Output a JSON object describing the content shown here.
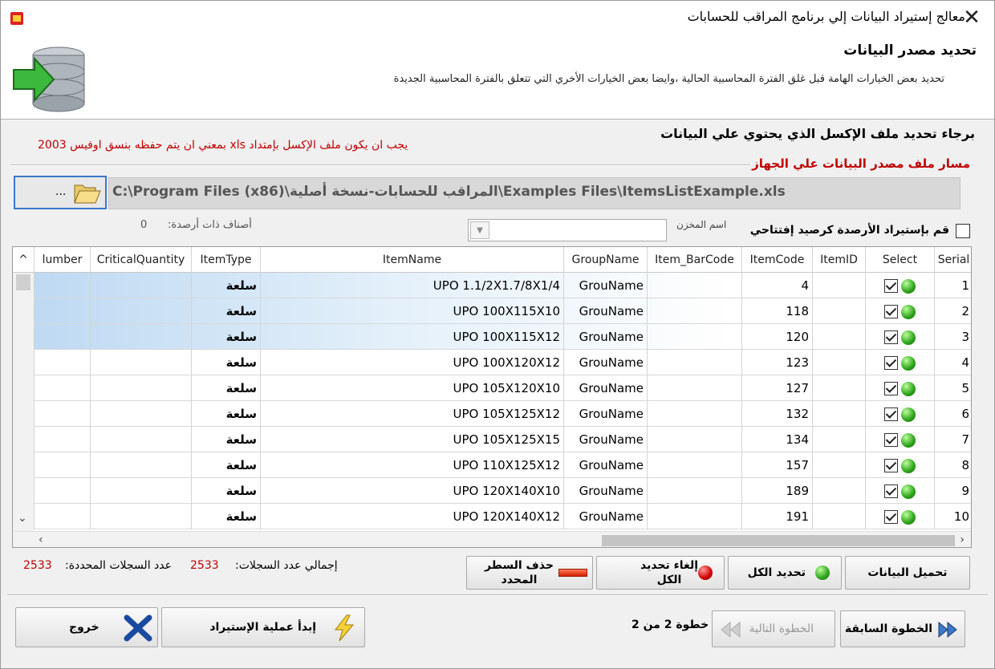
{
  "window": {
    "title": "معالج إستيراد البيانات إلي برنامج المراقب للحسابات"
  },
  "header": {
    "title": "تحديد مصدر البيانات",
    "subtitle": "تحديد بعض الخيارات الهامة قبل غلق الفترة المحاسبية الحالية ،وايضا بعض الخيارات الأخري التي تتعلق بالفترة المحاسبية الجديدة"
  },
  "source": {
    "instruction": "برجاء تحديد ملف الإكسل الذي يحتوي علي البيانات",
    "warning": "يجب ان يكون ملف الإكسل بإمتداد xls بمعني ان يتم حفظه بنسق اوفيس 2003",
    "group_label": "مسار ملف مصدر البيانات علي الجهاز",
    "browse_label": "...",
    "path": "C:\\Program Files (x86)\\المراقب للحسابات-نسخة أصلية\\Examples Files\\ItemsListExample.xls"
  },
  "options": {
    "import_balances_label": "قم بإستيراد الأرصدة كرصيد إفتتاحي",
    "warehouse_label": "اسم المخزن",
    "warehouse_value": "",
    "items_with_balance_label": "أصناف ذات أرصدة:",
    "items_with_balance_value": "0"
  },
  "grid": {
    "columns": [
      "Serial",
      "Select",
      "ItemID",
      "ItemCode",
      "Item_BarCode",
      "GroupName",
      "ItemName",
      "ItemType",
      "CriticalQuantity",
      "lumber"
    ],
    "rows": [
      {
        "serial": "1",
        "item_id": "",
        "item_code": "4",
        "barcode": "",
        "group": "GrouName",
        "name": "UPO 1.1/2X1.7/8X1/4",
        "type": "سلعة",
        "critical": "",
        "number": ""
      },
      {
        "serial": "2",
        "item_id": "",
        "item_code": "118",
        "barcode": "",
        "group": "GrouName",
        "name": "UPO 100X115X10",
        "type": "سلعة",
        "critical": "",
        "number": ""
      },
      {
        "serial": "3",
        "item_id": "",
        "item_code": "120",
        "barcode": "",
        "group": "GrouName",
        "name": "UPO 100X115X12",
        "type": "سلعة",
        "critical": "",
        "number": ""
      },
      {
        "serial": "4",
        "item_id": "",
        "item_code": "123",
        "barcode": "",
        "group": "GrouName",
        "name": "UPO 100X120X12",
        "type": "سلعة",
        "critical": "",
        "number": ""
      },
      {
        "serial": "5",
        "item_id": "",
        "item_code": "127",
        "barcode": "",
        "group": "GrouName",
        "name": "UPO 105X120X10",
        "type": "سلعة",
        "critical": "",
        "number": ""
      },
      {
        "serial": "6",
        "item_id": "",
        "item_code": "132",
        "barcode": "",
        "group": "GrouName",
        "name": "UPO 105X125X12",
        "type": "سلعة",
        "critical": "",
        "number": ""
      },
      {
        "serial": "7",
        "item_id": "",
        "item_code": "134",
        "barcode": "",
        "group": "GrouName",
        "name": "UPO 105X125X15",
        "type": "سلعة",
        "critical": "",
        "number": ""
      },
      {
        "serial": "8",
        "item_id": "",
        "item_code": "157",
        "barcode": "",
        "group": "GrouName",
        "name": "UPO 110X125X12",
        "type": "سلعة",
        "critical": "",
        "number": ""
      },
      {
        "serial": "9",
        "item_id": "",
        "item_code": "189",
        "barcode": "",
        "group": "GrouName",
        "name": "UPO 120X140X10",
        "type": "سلعة",
        "critical": "",
        "number": ""
      },
      {
        "serial": "10",
        "item_id": "",
        "item_code": "191",
        "barcode": "",
        "group": "GrouName",
        "name": "UPO 120X140X12",
        "type": "سلعة",
        "critical": "",
        "number": ""
      }
    ]
  },
  "actions": {
    "load_data": "تحميل البيانات",
    "select_all": "تحديد الكل",
    "deselect_all": "إلغاء تحديد الكل",
    "delete_row": "حذف السطر المحدد"
  },
  "summary": {
    "total_label": "إجمالي عدد السجلات:",
    "total_value": "2533",
    "selected_label": "عدد السجلات المحددة:",
    "selected_value": "2533"
  },
  "footer": {
    "back": "الخطوة السابقة",
    "next": "الخطوة التالية",
    "step": "خطوة 2 من 2",
    "start_import": "إبدأ عملية الإستيراد",
    "exit": "خروج"
  },
  "colors": {
    "accent_red": "#c00000",
    "select_blue": "#3a78c8"
  }
}
